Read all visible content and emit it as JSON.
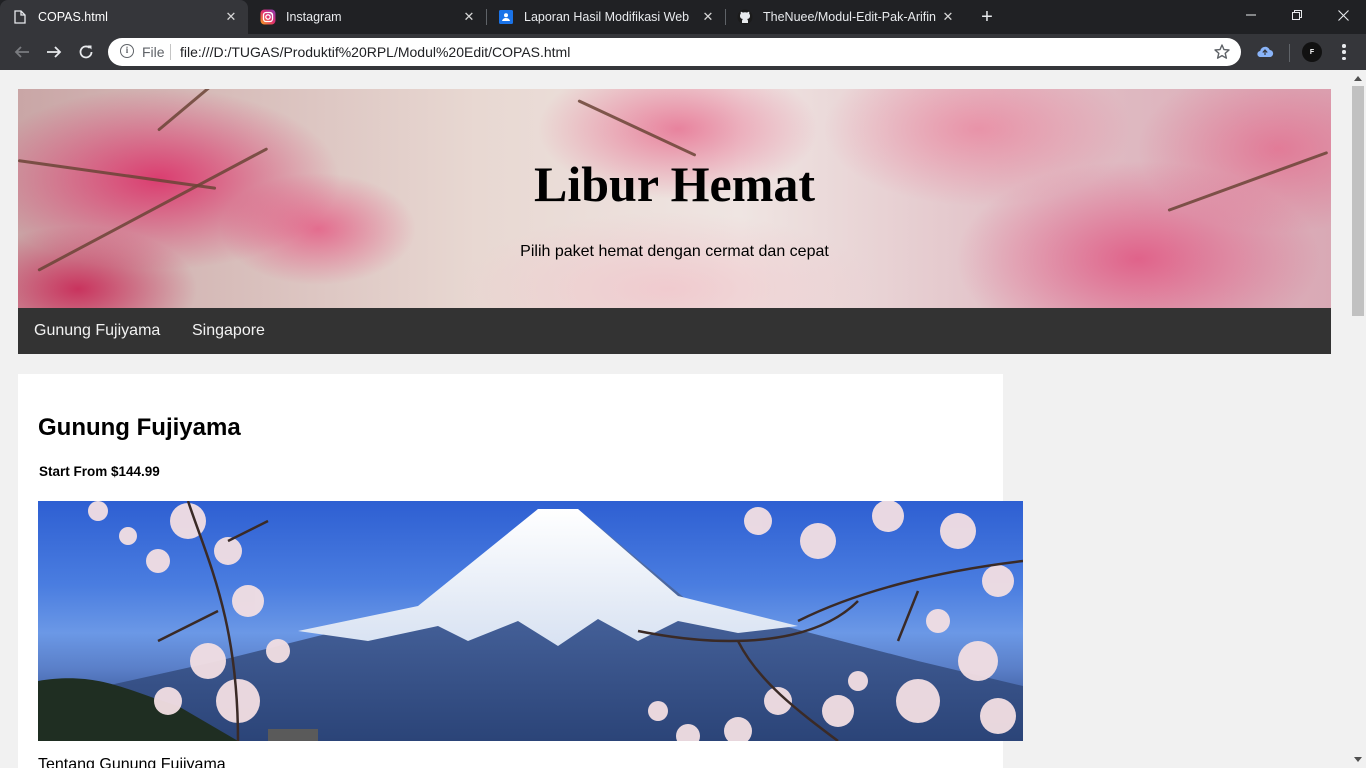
{
  "browser": {
    "tabs": [
      {
        "title": "COPAS.html",
        "icon": "file-icon",
        "active": true
      },
      {
        "title": "Instagram",
        "icon": "instagram-icon",
        "active": false
      },
      {
        "title": "Laporan Hasil Modifikasi Web",
        "icon": "docs-icon",
        "active": false
      },
      {
        "title": "TheNuee/Modul-Edit-Pak-Arifin",
        "icon": "github-icon",
        "active": false
      }
    ],
    "scheme_label": "File",
    "url": "file:///D:/TUGAS/Produktif%20RPL/Modul%20Edit/COPAS.html",
    "profile_initial": "F",
    "accent": "#202124"
  },
  "page": {
    "header": {
      "title": "Libur Hemat",
      "subtitle": "Pilih paket hemat dengan cermat dan cepat"
    },
    "nav": [
      "Gunung Fujiyama",
      "Singapore"
    ],
    "card": {
      "title": "Gunung Fujiyama",
      "price": "Start From $144.99",
      "caption": "Tentang Gunung Fujiyama"
    },
    "nav_bg": "#333333"
  }
}
